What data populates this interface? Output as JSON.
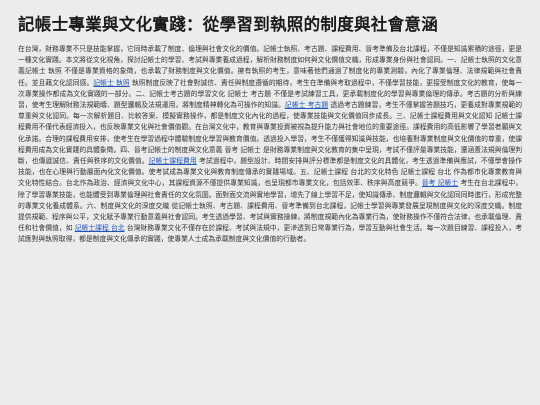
{
  "title": "記帳士專業與文化實踐：從學習到執照的制度與社會意涵",
  "link_color": "#1e56b8",
  "segments": [
    {
      "t": "text",
      "v": "在台灣，財務專業不只是技能掌握，它同時承載了制度、倫理與社會文化的價值。記帳士執照、考古題、課程費用、晉考準備及台北課程，不僅是知識累積的途徑，更是一種文化實踐。本文將從文化視角，探討記帳士的學習、考試與專業養成過程，解析財務制度如何與文化價值交織，形成專業身份與社會認同。一、記帳士執照的文化意義記帳士 執照 不僅是專業資格的象徵，也承載了財務制度與文化價值。擁有執照的考生，意味著他們通過了制度化的專業測驗，內化了專業倫理、法律規範與社會責任。並且藉文化認同感。"
    },
    {
      "t": "link",
      "v": "記帳士 執照"
    },
    {
      "t": "text",
      "v": " 執照制度反映了社會對誠信、責任與制度遵循的期待，考生在準備與考取過程中，不僅學習技能，更接受制度文化的教育，使每一次專業操作都成為文化實踐的一部分。二、記帳士考古題的學習文化 記帳士 考古題 不僅是考試練習工具，更承載制度化的學習與專業倫理的傳承。考古題的分析與練習，使考生理解財務法規範疇、題型邏輯及法規運用，將制度精神轉化為可操作的知識。"
    },
    {
      "t": "link",
      "v": "記帳士 考古題"
    },
    {
      "t": "text",
      "v": " 透過考古題練習，考生不僅掌握答題技巧，更養成對專業規範的尊重與文化認同。每一次解析題目、比較答案、模擬實務操作，都是制度文化內化的過程，使專業技能與文化價值同步成長。三、記帳士課程費用與文化認知 記帳士課程費用不僅代表經濟投入，也反映專業文化與社會價值觀。在台灣文化中，教育與專業投資被視為提升能力與社會地位的重要途徑。課程費用的高低影響了學習者願與文化承諾。合理的課程費用安排，使考生在學習過程中體驗制度化學習與教育價值。透過投入學習，考生不僅獲得知識與技能，也培養對專業制度與文化價值的尊重，使課程費用成為文化實踐的具體象徵。四、晉考記帳士的制度與文化意義 晉考 記帳士 是財務專業制度與文化教育的集中呈現，考試不僅評量專業技能，還涵蓋法規與倫理判斷，也傳遞誠信、責任與秩序的文化價值。"
    },
    {
      "t": "link",
      "v": "記帳士課程費用"
    },
    {
      "t": "text",
      "v": " 考試過程中，題型設計、時間安排與評分標準都是制度文化的具體化，考生透過準備與應試，不僅學會操作技能，也在心理與行動層面內化文化價值。使考試成為專業文化與教育制度傳承的實踐場域。五、記帳士課程 台北的文化特色 記帳士課程 台北 作為都市化專業教育與文化特性結合。台北作為政治、經濟與文化中心，其課程資源不僅提供專業知識，也呈現都市專業文化，包括效率、秩序與高度競爭。"
    },
    {
      "t": "link",
      "v": "晉考 記帳士"
    },
    {
      "t": "text",
      "v": " 考生在台北課程中，除了學習專業技能，也能體受到專業倫理與社會責任的文化氛圍。面對面交流與實地學習，增先了線上學習不足，使知識傳承、制度邏輯與文化認同同時進行，形成完整的專業文化養成體系。六、制度與文化的深度交織 從記帳士執照、考古題、課程費用、晉考準備到台北課程，記帳士學習與專業發展呈現制度與文化的深度交織。制度提供規範、程序與公平，文化賦予專業行動意義與社會認同。考生透過學習、考試與實務操練，將制度規範內化為專業行為，使財務操作不僅符合法律，也承載倫理、責任和社會價值，如 "
    },
    {
      "t": "link",
      "v": "記帳士課程 台北"
    },
    {
      "t": "text",
      "v": " 台灣財務專業文化不僅存在於課程、考試與法規中，更滲透到日常專業行為，學習互動與社會生活。每一次題目練習、課程投入，考試應對與執照取得，都是制度與文化傳承的實踐，使專業人士成為承載制度與文化價值的行動者。"
    }
  ]
}
